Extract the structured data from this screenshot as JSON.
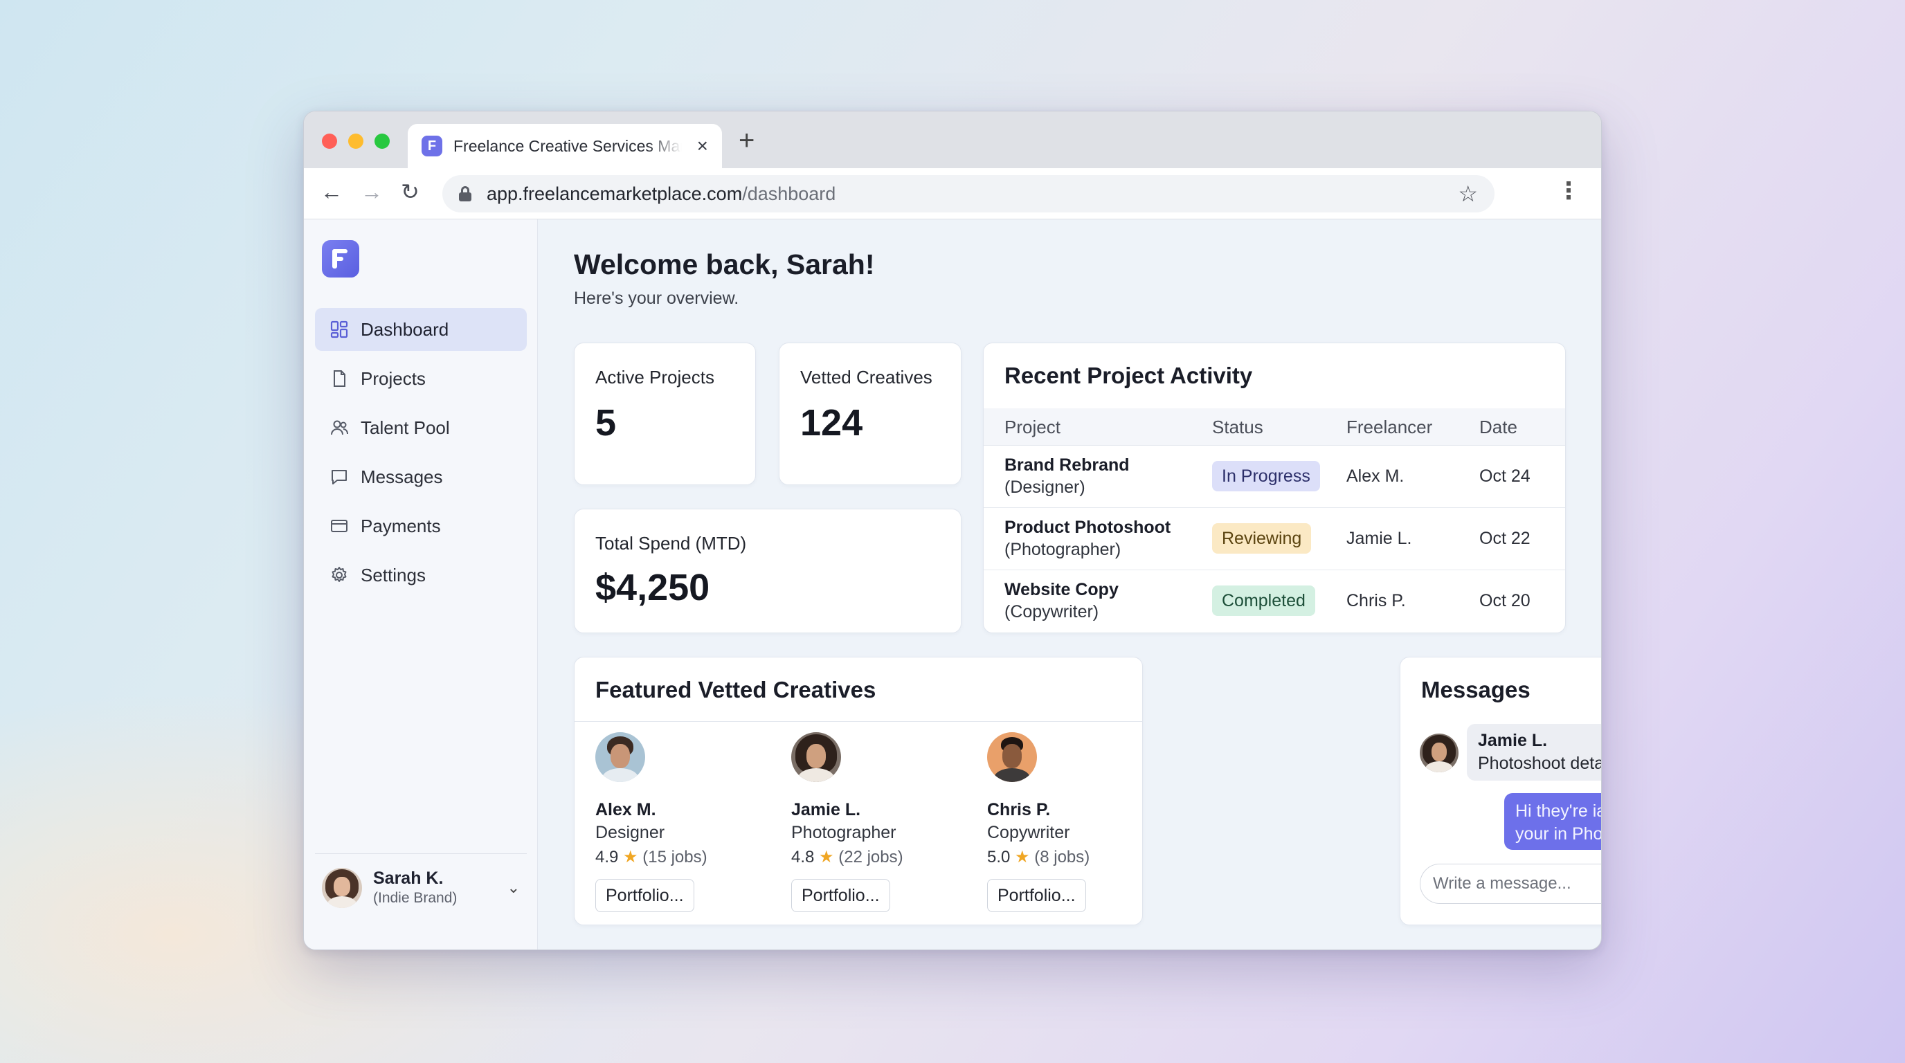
{
  "browser": {
    "tab_title": "Freelance Creative Services Marketplace",
    "tab_favicon": "F",
    "new_tab_icon": "plus-icon",
    "url_host": "app.freelancemarketplace.com",
    "url_path": "/dashboard"
  },
  "sidebar": {
    "items": [
      {
        "label": "Dashboard",
        "icon": "dashboard-icon",
        "active": true
      },
      {
        "label": "Projects",
        "icon": "document-icon"
      },
      {
        "label": "Talent Pool",
        "icon": "users-icon"
      },
      {
        "label": "Messages",
        "icon": "chat-bubble-icon"
      },
      {
        "label": "Payments",
        "icon": "credit-card-icon"
      },
      {
        "label": "Settings",
        "icon": "gear-icon"
      }
    ],
    "user": {
      "name": "Sarah K.",
      "subtitle": "(Indie Brand)"
    }
  },
  "main": {
    "greeting": "Welcome back, Sarah!",
    "subgreeting": "Here's your overview.",
    "stats": {
      "active_projects": {
        "label": "Active Projects",
        "value": "5"
      },
      "vetted_creatives": {
        "label": "Vetted Creatives",
        "value": "124"
      },
      "total_spend": {
        "label": "Total Spend (MTD)",
        "value": "$4,250"
      }
    },
    "activity": {
      "title": "Recent Project Activity",
      "columns": [
        "Project",
        "Status",
        "Freelancer",
        "Date"
      ],
      "rows": [
        {
          "project": "Brand Rebrand",
          "role": "(Designer)",
          "status": "In Progress",
          "freelancer": "Alex M.",
          "date": "Oct 24"
        },
        {
          "project": "Product Photoshoot",
          "role": "(Photographer)",
          "status": "Reviewing",
          "freelancer": "Jamie L.",
          "date": "Oct 22"
        },
        {
          "project": "Website Copy",
          "role": "(Copywriter)",
          "status": "Completed",
          "freelancer": "Chris P.",
          "date": "Oct 20"
        }
      ]
    },
    "featured": {
      "title": "Featured Vetted Creatives",
      "creatives": [
        {
          "name": "Alex M.",
          "role": "Designer",
          "rating": "4.9",
          "jobs": "(15 jobs)",
          "button": "Portfolio..."
        },
        {
          "name": "Jamie L.",
          "role": "Photographer",
          "rating": "4.8",
          "jobs": "(22 jobs)",
          "button": "Portfolio..."
        },
        {
          "name": "Chris P.",
          "role": "Copywriter",
          "rating": "5.0",
          "jobs": "(8 jobs)",
          "button": "Portfolio..."
        }
      ]
    },
    "messages": {
      "title": "Messages",
      "incoming": {
        "name": "Jamie L.",
        "text": "Photoshoot details"
      },
      "outgoing": "Hi they're iael that can id irwith your in Photoshoot details?",
      "input_placeholder": "Write a message..."
    }
  },
  "colors": {
    "accent": "#6d70ea",
    "status_in_progress": "#dcdff9",
    "status_reviewing": "#fbe9c4",
    "status_completed": "#d4f0e2"
  }
}
